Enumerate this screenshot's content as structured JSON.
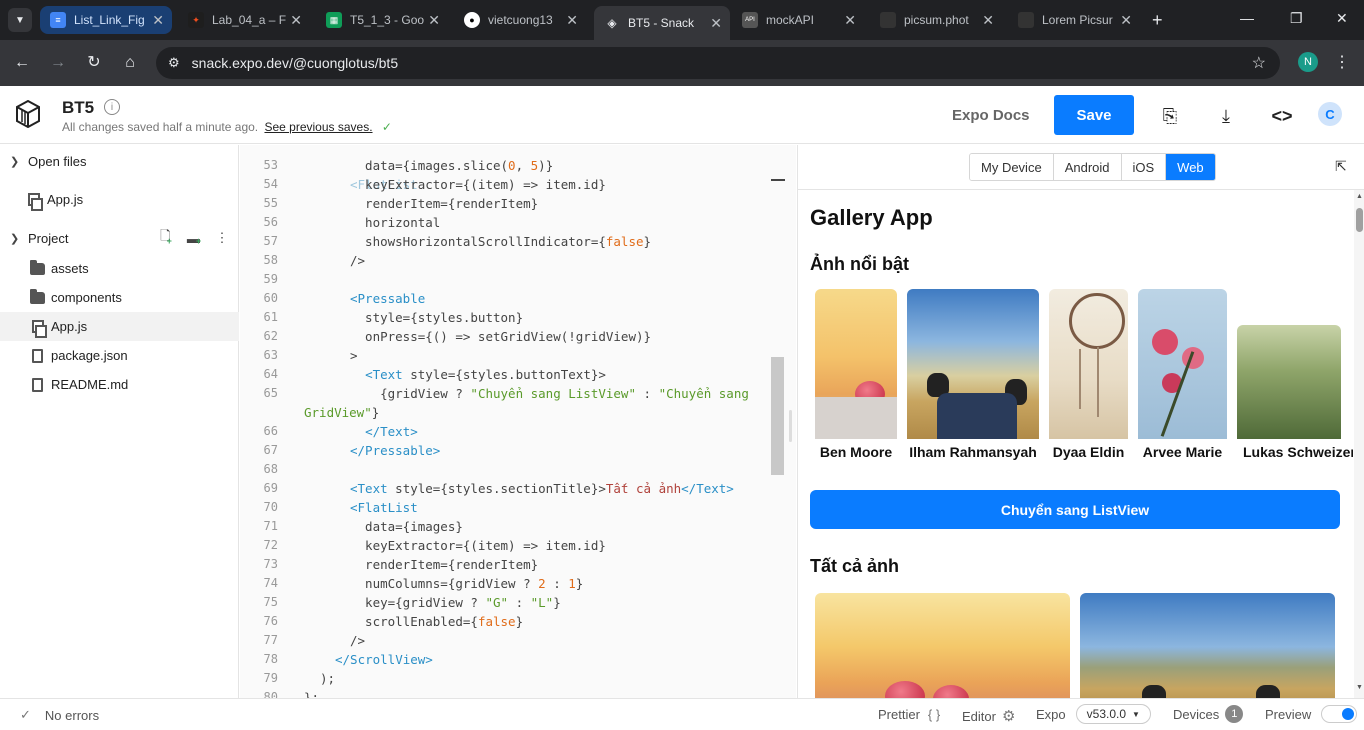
{
  "browser": {
    "tabs": [
      {
        "title": "List_Link_Fig",
        "icon": "google-docs-icon",
        "color": "#4285f4"
      },
      {
        "title": "Lab_04_a – F",
        "icon": "figma-icon",
        "color": "#a259ff"
      },
      {
        "title": "T5_1_3 - Goo",
        "icon": "google-sheets-icon",
        "color": "#0f9d58"
      },
      {
        "title": "vietcuong13",
        "icon": "github-icon",
        "color": "#ffffff"
      },
      {
        "title": "BT5 - Snack",
        "icon": "expo-snack-icon",
        "color": "#ffffff"
      },
      {
        "title": "mockAPI",
        "icon": "mockapi-icon",
        "color": "#555555"
      },
      {
        "title": "picsum.phot",
        "icon": "picsum-icon",
        "color": "#333333"
      },
      {
        "title": "Lorem Picsur",
        "icon": "picsum-icon",
        "color": "#333333"
      }
    ],
    "url": "snack.expo.dev/@cuonglotus/bt5",
    "profile_initial": "N"
  },
  "header": {
    "project_name": "BT5",
    "save_status": "All changes saved half a minute ago.",
    "save_link": "See previous saves.",
    "expo_docs": "Expo Docs",
    "save_label": "Save",
    "user_initial": "C"
  },
  "sidebar": {
    "open_files_label": "Open files",
    "open_files": [
      "App.js"
    ],
    "project_label": "Project",
    "project_items": [
      {
        "name": "assets",
        "type": "folder"
      },
      {
        "name": "components",
        "type": "folder"
      },
      {
        "name": "App.js",
        "type": "file"
      },
      {
        "name": "package.json",
        "type": "doc"
      },
      {
        "name": "README.md",
        "type": "doc"
      }
    ]
  },
  "editor": {
    "lines": [
      {
        "n": "53",
        "html": "  data={images.slice(<span class='t-num'>0</span>, <span class='t-num'>5</span>)}"
      },
      {
        "n": "54",
        "html": "  keyExtractor={(item) => item.id}"
      },
      {
        "n": "55",
        "html": "  renderItem={renderItem}"
      },
      {
        "n": "56",
        "html": "  horizontal"
      },
      {
        "n": "57",
        "html": "  showsHorizontalScrollIndicator={<span class='t-kw'>false</span>}"
      },
      {
        "n": "58",
        "html": "/>"
      },
      {
        "n": "59",
        "html": ""
      },
      {
        "n": "60",
        "html": "<span class='t-tag'>&lt;Pressable</span>"
      },
      {
        "n": "61",
        "html": "  style={styles.button}"
      },
      {
        "n": "62",
        "html": "  onPress={() => setGridView(!gridView)}"
      },
      {
        "n": "63",
        "html": "&gt;"
      },
      {
        "n": "64",
        "html": "  <span class='t-tag'>&lt;Text</span> style={styles.buttonText}&gt;"
      },
      {
        "n": "65",
        "html": "    {gridView ? <span class='t-str'>\"Chuyển sang ListView\"</span> : <span class='t-str'>\"Chuyển sang</span>"
      },
      {
        "n": "",
        "html": "<span class='t-str'>GridView\"</span>}",
        "wrap": true
      },
      {
        "n": "66",
        "html": "  <span class='t-tag'>&lt;/Text&gt;</span>"
      },
      {
        "n": "67",
        "html": "<span class='t-tag'>&lt;/Pressable&gt;</span>"
      },
      {
        "n": "68",
        "html": ""
      },
      {
        "n": "69",
        "html": "<span class='t-tag'>&lt;Text</span> style={styles.sectionTitle}&gt;<span class='t-viet'>Tất cả ảnh</span><span class='t-tag'>&lt;/Text&gt;</span>"
      },
      {
        "n": "70",
        "html": "<span class='t-tag'>&lt;FlatList</span>"
      },
      {
        "n": "71",
        "html": "  data={images}"
      },
      {
        "n": "72",
        "html": "  keyExtractor={(item) => item.id}"
      },
      {
        "n": "73",
        "html": "  renderItem={renderItem}"
      },
      {
        "n": "74",
        "html": "  numColumns={gridView ? <span class='t-num'>2</span> : <span class='t-num'>1</span>}"
      },
      {
        "n": "75",
        "html": "  key={gridView ? <span class='t-str'>\"G\"</span> : <span class='t-str'>\"L\"</span>}"
      },
      {
        "n": "76",
        "html": "  scrollEnabled={<span class='t-kw'>false</span>}"
      },
      {
        "n": "77",
        "html": "/>"
      },
      {
        "n": "78",
        "html": "<span class='t-tag'>&lt;/ScrollView&gt;</span>",
        "outdent": 1
      },
      {
        "n": "79",
        "html": ");",
        "outdent": 2
      },
      {
        "n": "80",
        "html": "};",
        "outdent": 3
      }
    ]
  },
  "preview": {
    "device_tabs": [
      "My Device",
      "Android",
      "iOS",
      "Web"
    ],
    "active_device": "Web",
    "app_title": "Gallery App",
    "featured_title": "Ảnh nổi bật",
    "featured_authors": [
      "Ben Moore",
      "Ilham Rahmansyah",
      "Dyaa Eldin",
      "Arvee Marie",
      "Lukas Schweizer"
    ],
    "toggle_button": "Chuyển sang ListView",
    "all_title": "Tất cả ảnh"
  },
  "statusbar": {
    "errors": "No errors",
    "prettier": "Prettier",
    "editor": "Editor",
    "expo": "Expo",
    "sdk_version": "v53.0.0",
    "devices": "Devices",
    "devices_count": "1",
    "preview": "Preview"
  }
}
